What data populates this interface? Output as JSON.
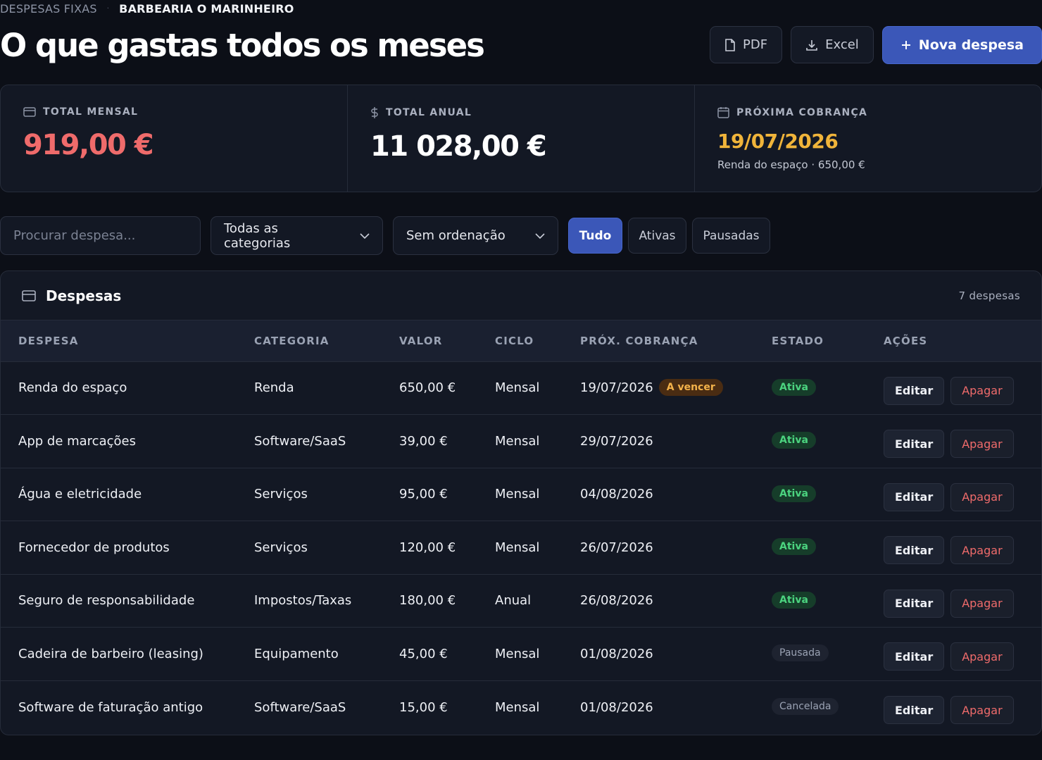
{
  "breadcrumb": {
    "section": "DESPESAS FIXAS",
    "separator": "·",
    "business": "BARBEARIA O MARINHEIRO"
  },
  "page": {
    "title": "O que gastas todos os meses"
  },
  "actions": {
    "pdf": "PDF",
    "excel": "Excel",
    "new": "Nova despesa"
  },
  "stats": {
    "monthly": {
      "label": "TOTAL MENSAL",
      "value": "919,00 €"
    },
    "yearly": {
      "label": "TOTAL ANUAL",
      "value": "11 028,00 €"
    },
    "next": {
      "label": "PRÓXIMA COBRANÇA",
      "value": "19/07/2026",
      "sub": "Renda do espaço · 650,00 €"
    }
  },
  "filters": {
    "search_placeholder": "Procurar despesa...",
    "category": "Todas as categorias",
    "sort": "Sem ordenação",
    "tabs": [
      "Tudo",
      "Ativas",
      "Pausadas"
    ]
  },
  "table": {
    "title": "Despesas",
    "count": "7 despesas",
    "headers": [
      "DESPESA",
      "CATEGORIA",
      "VALOR",
      "CICLO",
      "PRÓX. COBRANÇA",
      "ESTADO",
      "AÇÕES"
    ],
    "edit_label": "Editar",
    "delete_label": "Apagar",
    "rows": [
      {
        "name": "Renda do espaço",
        "category": "Renda",
        "value": "650,00 €",
        "cycle": "Mensal",
        "next": "19/07/2026",
        "due": "A vencer",
        "status": "Ativa",
        "status_kind": "ativa"
      },
      {
        "name": "App de marcações",
        "category": "Software/SaaS",
        "value": "39,00 €",
        "cycle": "Mensal",
        "next": "29/07/2026",
        "due": "",
        "status": "Ativa",
        "status_kind": "ativa"
      },
      {
        "name": "Água e eletricidade",
        "category": "Serviços",
        "value": "95,00 €",
        "cycle": "Mensal",
        "next": "04/08/2026",
        "due": "",
        "status": "Ativa",
        "status_kind": "ativa"
      },
      {
        "name": "Fornecedor de produtos",
        "category": "Serviços",
        "value": "120,00 €",
        "cycle": "Mensal",
        "next": "26/07/2026",
        "due": "",
        "status": "Ativa",
        "status_kind": "ativa"
      },
      {
        "name": "Seguro de responsabilidade",
        "category": "Impostos/Taxas",
        "value": "180,00 €",
        "cycle": "Anual",
        "next": "26/08/2026",
        "due": "",
        "status": "Ativa",
        "status_kind": "ativa"
      },
      {
        "name": "Cadeira de barbeiro (leasing)",
        "category": "Equipamento",
        "value": "45,00 €",
        "cycle": "Mensal",
        "next": "01/08/2026",
        "due": "",
        "status": "Pausada",
        "status_kind": "pausada"
      },
      {
        "name": "Software de faturação antigo",
        "category": "Software/SaaS",
        "value": "15,00 €",
        "cycle": "Mensal",
        "next": "01/08/2026",
        "due": "",
        "status": "Cancelada",
        "status_kind": "cancelada"
      }
    ]
  },
  "colors": {
    "accent": "#3b57b8",
    "danger": "#ef6b6b",
    "warning": "#f0b43a",
    "success": "#4bd37f"
  }
}
